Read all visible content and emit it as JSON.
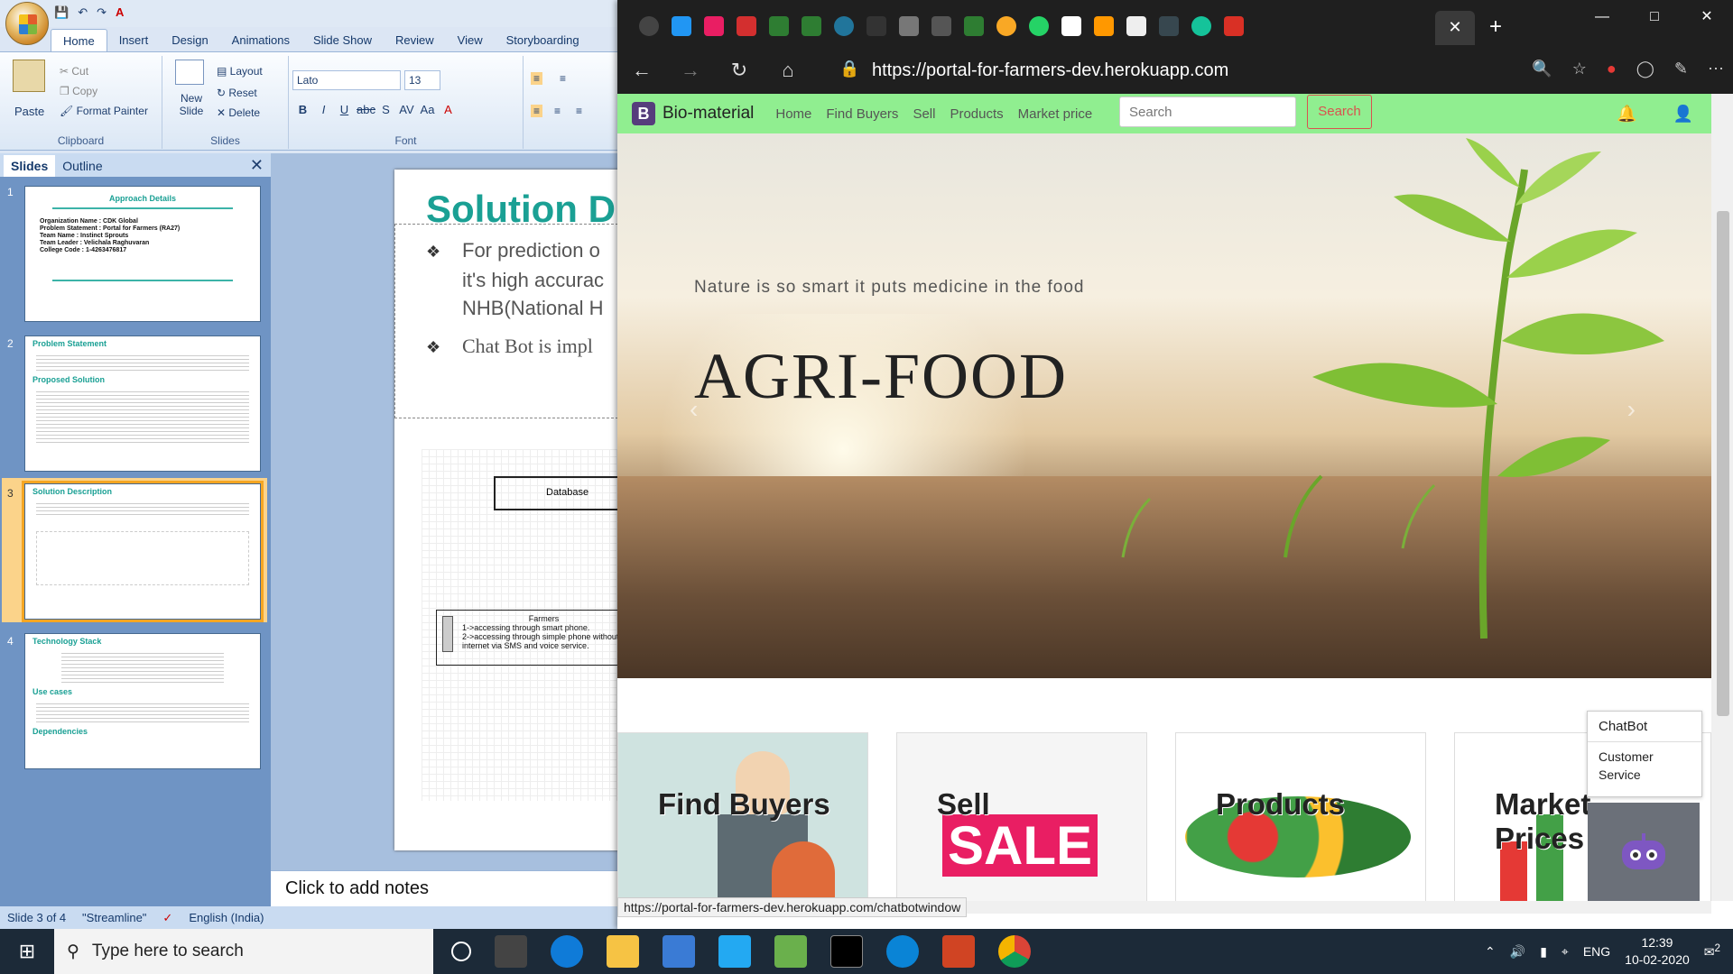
{
  "ppt": {
    "qat_icons": [
      "save-icon",
      "undo-icon",
      "redo-icon",
      "font-color-icon"
    ],
    "tabs": [
      "Home",
      "Insert",
      "Design",
      "Animations",
      "Slide Show",
      "Review",
      "View",
      "Storyboarding"
    ],
    "clipboard": {
      "paste": "Paste",
      "cut": "Cut",
      "copy": "Copy",
      "format_painter": "Format Painter",
      "label": "Clipboard"
    },
    "slides_group": {
      "new_slide": "New Slide",
      "layout": "Layout",
      "reset": "Reset",
      "delete": "Delete",
      "label": "Slides"
    },
    "font_group": {
      "font": "Lato",
      "size": "13",
      "label": "Font"
    },
    "pane_tabs": [
      "Slides",
      "Outline"
    ],
    "thumbs": [
      {
        "num": "1",
        "title": "Approach Details",
        "lines": [
          "Organization Name : CDK Global",
          "Problem Statement : Portal for Farmers (RA27)",
          "Team Name : Instinct Sprouts",
          "Team Leader : Velichala Raghuvaran",
          "College Code : 1-4263476817"
        ]
      },
      {
        "num": "2",
        "title": "Problem Statement",
        "sub": "Proposed Solution"
      },
      {
        "num": "3",
        "title": "Solution Description"
      },
      {
        "num": "4",
        "title": "Technology Stack",
        "sub": "Use cases",
        "sub2": "Dependencies"
      }
    ],
    "slide": {
      "title": "Solution D",
      "bullet1": [
        "For prediction o",
        "it's high accurac",
        "NHB(National H"
      ],
      "bullet2": "Chat Bot is impl",
      "db": "Database",
      "farmers": [
        "Farmers",
        "1->accessing through smart phone.",
        "2->accessing through simple phone without",
        "internet via SMS and voice service."
      ]
    },
    "notes_placeholder": "Click to add notes",
    "status": {
      "slide": "Slide 3 of 4",
      "theme": "\"Streamline\"",
      "lang": "English (India)"
    }
  },
  "browser": {
    "url": "https://portal-for-farmers-dev.herokuapp.com",
    "hover_url": "https://portal-for-farmers-dev.herokuapp.com/chatbotwindow",
    "site": {
      "brand": "Bio-material",
      "brand_letter": "B",
      "nav": [
        "Home",
        "Find Buyers",
        "Sell",
        "Products",
        "Market price"
      ],
      "search_placeholder": "Search",
      "search_button": "Search",
      "hero_sub": "Nature is so smart it puts medicine in the food",
      "hero_title": "AGRI-FOOD",
      "cards": [
        {
          "label": "Find Buyers"
        },
        {
          "label": "Sell",
          "sale": "SALE"
        },
        {
          "label": "Products"
        },
        {
          "label": "Market",
          "label2": "Prices"
        }
      ],
      "chatbot": {
        "header": "ChatBot",
        "item": "Customer Service"
      }
    }
  },
  "taskbar": {
    "search": "Type here to search",
    "lang": "ENG",
    "time": "12:39",
    "date": "10-02-2020",
    "notif": "2"
  }
}
